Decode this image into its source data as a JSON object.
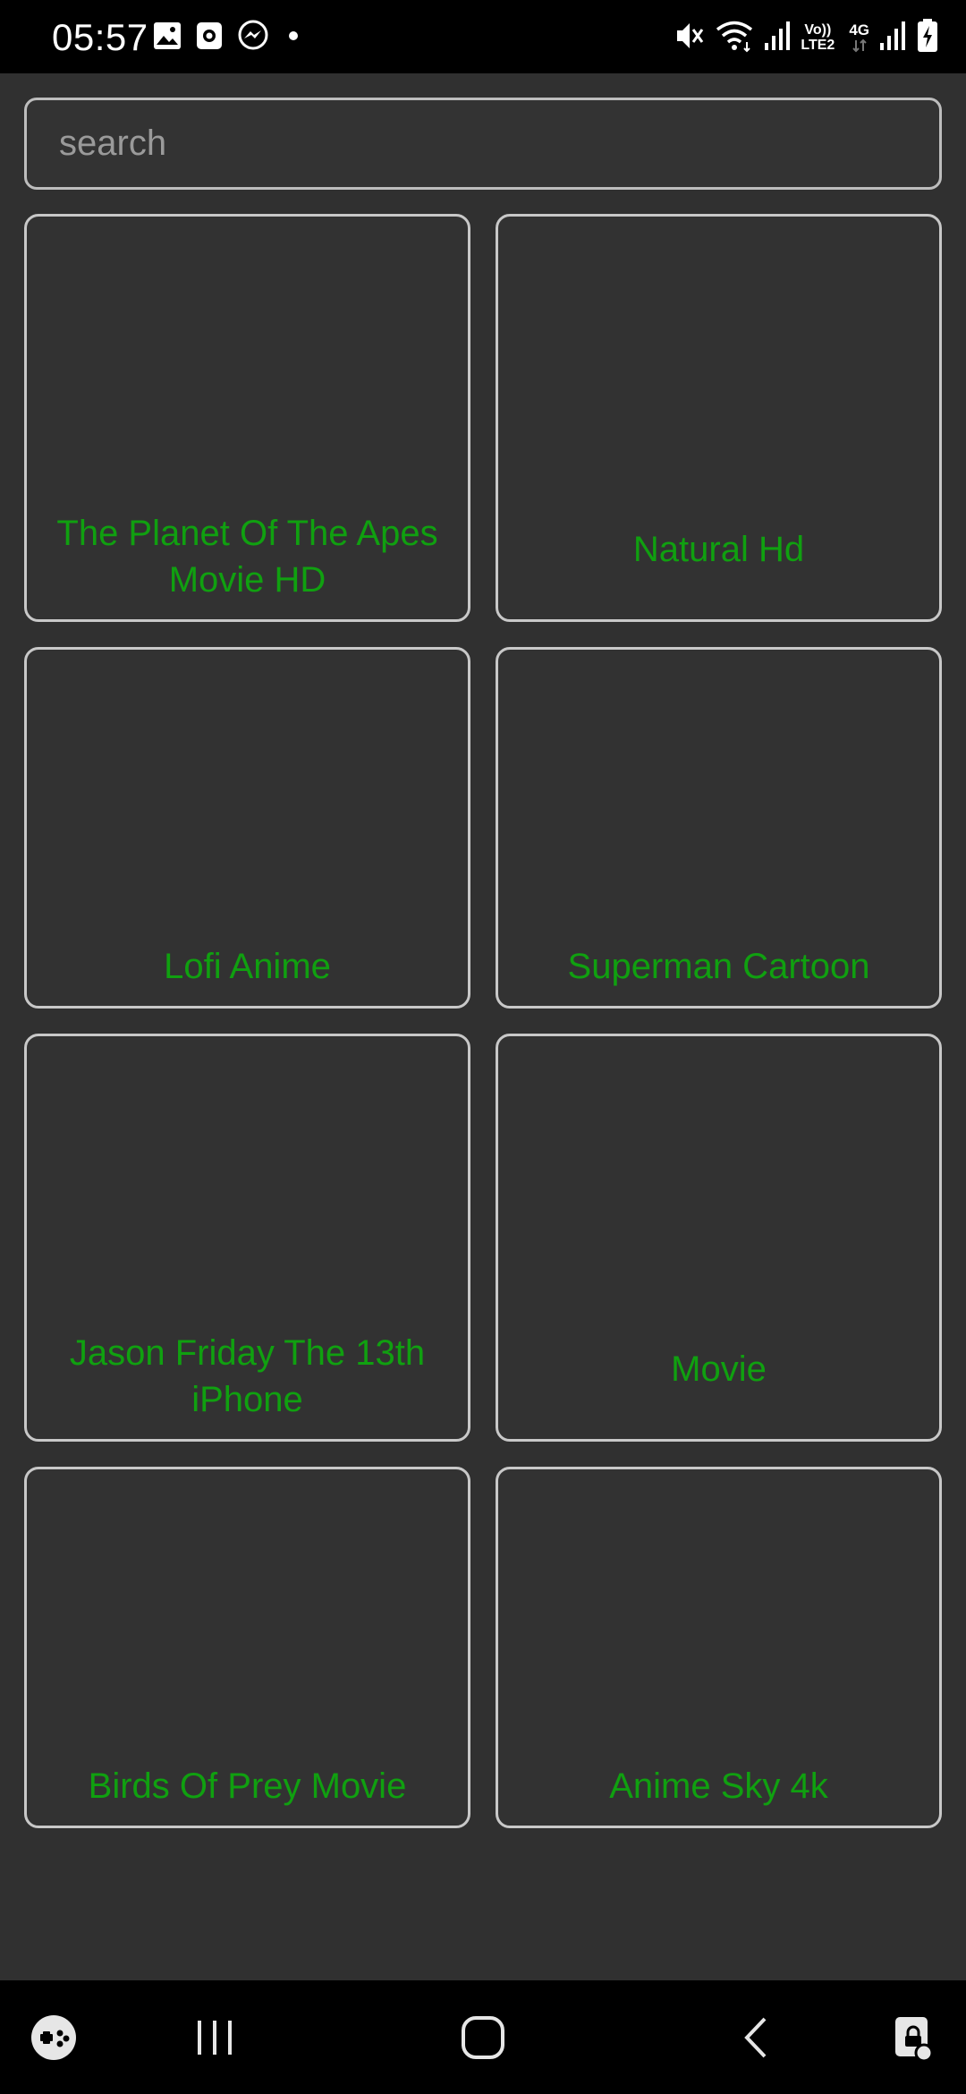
{
  "status_bar": {
    "time": "05:57",
    "left_icons": [
      "gallery-icon",
      "screen-recorder-icon",
      "messenger-icon",
      "notification-dot-icon"
    ],
    "right_icons": [
      "mute-icon",
      "wifi-icon",
      "signal-icon",
      "volte-icon",
      "4g-icon",
      "signal-icon",
      "battery-charging-icon"
    ],
    "volte_label_top": "Vo))",
    "volte_label_bottom": "LTE2",
    "network_label": "4G"
  },
  "search": {
    "placeholder": "search",
    "value": ""
  },
  "cards": [
    {
      "title": "The Planet Of The Apes Movie HD"
    },
    {
      "title": "Natural Hd"
    },
    {
      "title": "Lofi Anime"
    },
    {
      "title": "Superman Cartoon"
    },
    {
      "title": "Jason Friday The 13th iPhone"
    },
    {
      "title": "Movie"
    },
    {
      "title": "Birds Of Prey Movie"
    },
    {
      "title": "Anime Sky 4k"
    }
  ],
  "nav_bar": {
    "items": [
      "game-launcher-icon",
      "recent-apps-icon",
      "home-icon",
      "back-icon",
      "screen-lock-icon"
    ]
  },
  "colors": {
    "background": "#303030",
    "card_title": "#10a010",
    "card_border": "#c8c8c8",
    "status_bar": "#000000"
  }
}
